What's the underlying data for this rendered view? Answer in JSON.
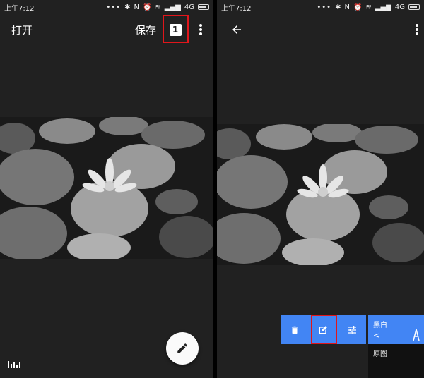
{
  "status": {
    "time": "上午7:12",
    "network": "4G"
  },
  "left": {
    "open_label": "打开",
    "save_label": "保存",
    "badge": "1"
  },
  "right": {
    "styles": {
      "selected": "黑白",
      "chevron": "<",
      "original": "原图"
    }
  },
  "colors": {
    "background": "#212121",
    "accent": "#4285f4",
    "highlight": "#e0161b",
    "fab": "#fafafa"
  },
  "icons": [
    "back-arrow-icon",
    "more-vert-icon",
    "edit-pencil-icon",
    "histogram-icon",
    "trash-icon",
    "edit-square-icon",
    "tune-icon",
    "compare-icon"
  ]
}
